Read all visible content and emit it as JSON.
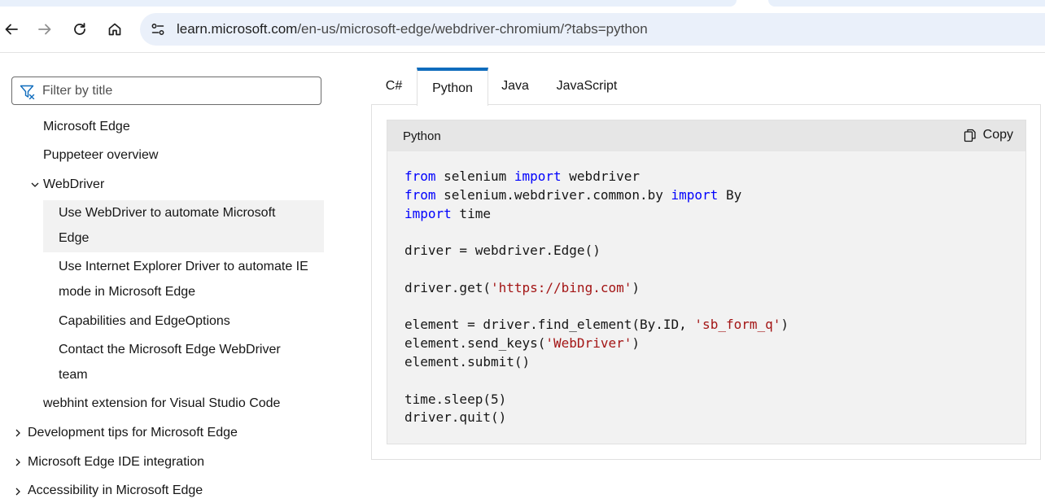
{
  "browser": {
    "url_host": "learn.microsoft.com",
    "url_path": "/en-us/microsoft-edge/webdriver-chromium/?tabs=python"
  },
  "sidebar": {
    "filter_placeholder": "Filter by title",
    "items": [
      {
        "label": "Microsoft Edge"
      },
      {
        "label": "Puppeteer overview"
      },
      {
        "label": "WebDriver"
      },
      {
        "label_line1": "Use WebDriver to automate Microsoft",
        "label_line2": "Edge"
      },
      {
        "label_line1": "Use Internet Explorer Driver to automate IE",
        "label_line2": "mode in Microsoft Edge"
      },
      {
        "label": "Capabilities and EdgeOptions"
      },
      {
        "label_line1": "Contact the Microsoft Edge WebDriver",
        "label_line2": "team"
      },
      {
        "label": "webhint extension for Visual Studio Code"
      },
      {
        "label": "Development tips for Microsoft Edge"
      },
      {
        "label": "Microsoft Edge IDE integration"
      },
      {
        "label": "Accessibility in Microsoft Edge"
      }
    ]
  },
  "tabs": [
    "C#",
    "Python",
    "Java",
    "JavaScript"
  ],
  "selected_tab": "Python",
  "code_block": {
    "language": "Python",
    "copy_label": "Copy",
    "lines": [
      [
        {
          "t": "from",
          "k": "kw"
        },
        {
          "t": " selenium "
        },
        {
          "t": "import",
          "k": "kw"
        },
        {
          "t": " webdriver"
        }
      ],
      [
        {
          "t": "from",
          "k": "kw"
        },
        {
          "t": " selenium.webdriver.common.by "
        },
        {
          "t": "import",
          "k": "kw"
        },
        {
          "t": " By"
        }
      ],
      [
        {
          "t": "import",
          "k": "kw"
        },
        {
          "t": " time"
        }
      ],
      [],
      [
        {
          "t": "driver = webdriver.Edge()"
        }
      ],
      [],
      [
        {
          "t": "driver.get("
        },
        {
          "t": "'https://bing.com'",
          "k": "str"
        },
        {
          "t": ")"
        }
      ],
      [],
      [
        {
          "t": "element = driver.find_element(By.ID, "
        },
        {
          "t": "'sb_form_q'",
          "k": "str"
        },
        {
          "t": ")"
        }
      ],
      [
        {
          "t": "element.send_keys("
        },
        {
          "t": "'WebDriver'",
          "k": "str"
        },
        {
          "t": ")"
        }
      ],
      [
        {
          "t": "element.submit()"
        }
      ],
      [],
      [
        {
          "t": "time.sleep(5)"
        }
      ],
      [
        {
          "t": "driver.quit()"
        }
      ]
    ]
  },
  "colors": {
    "accent": "#0f6cbd",
    "keyword": "#0101fd",
    "string": "#a31515",
    "omnibox": "#eaf0fa"
  }
}
